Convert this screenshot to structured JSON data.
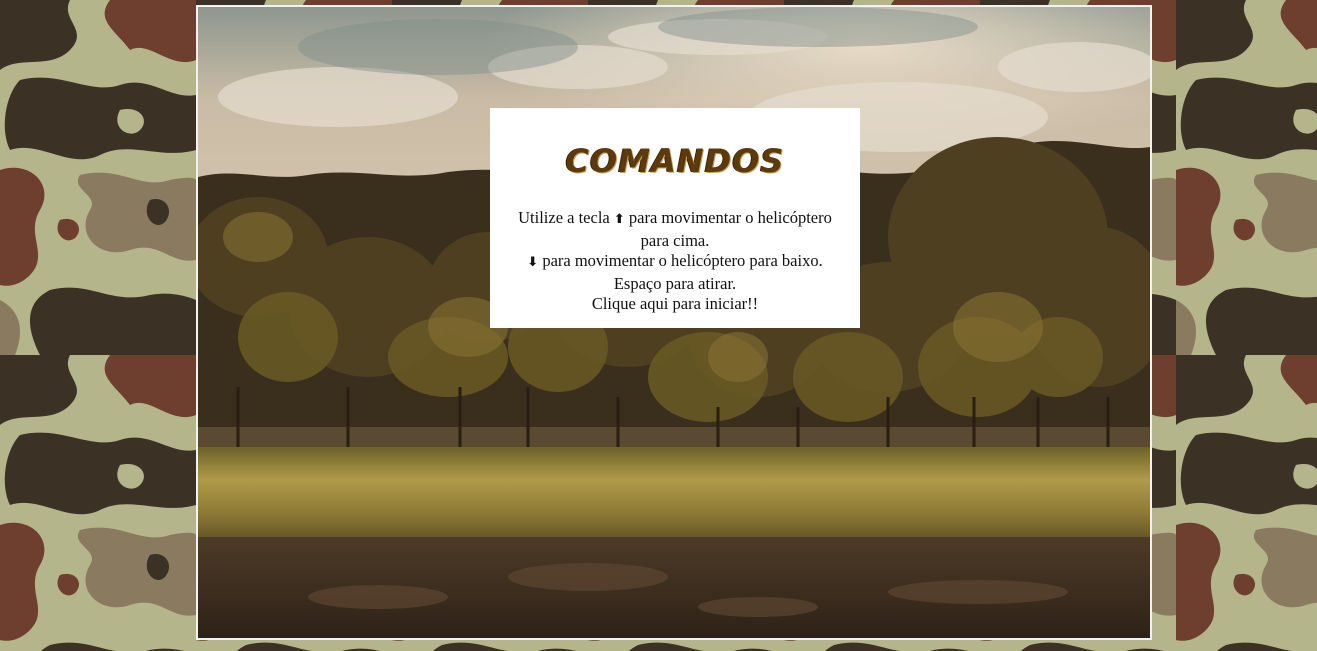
{
  "commands": {
    "title": "COMANDOS",
    "line1_prefix": "Utilize a tecla",
    "up_arrow": "⬆",
    "line1_suffix": "para movimentar o helicóptero",
    "line2": "para cima.",
    "down_arrow": "⬇",
    "line3_suffix": "para movimentar o helicóptero para baixo.",
    "line4": "Espaço para atirar.",
    "line5": "Clique aqui para iniciar!!"
  },
  "colors": {
    "title": "#5c3a0d",
    "panel_bg": "#ffffff",
    "frame_border": "#f2f2f2",
    "camo_light": "#b4b58a",
    "camo_dark": "#3b3225",
    "camo_brown": "#6e3f2e",
    "camo_mid": "#8a7a60"
  }
}
